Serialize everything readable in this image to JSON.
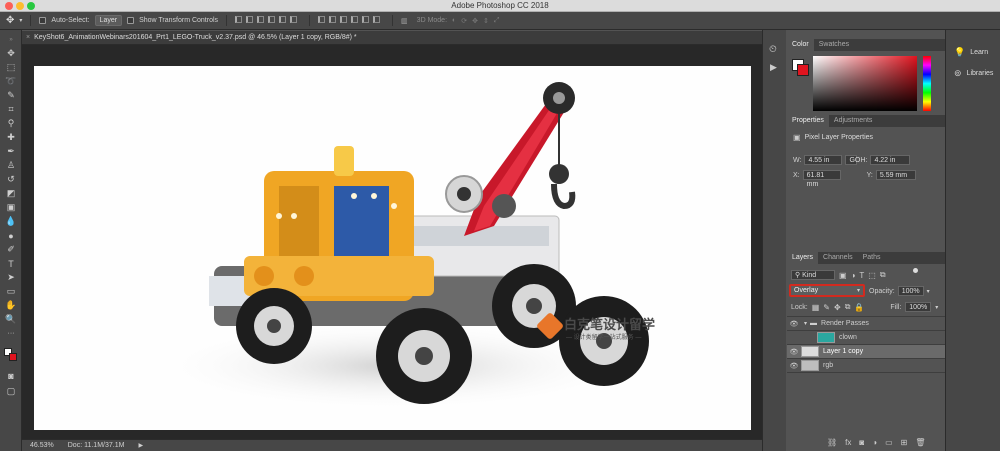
{
  "window": {
    "title": "Adobe Photoshop CC 2018"
  },
  "options_bar": {
    "auto_select_label": "Auto-Select:",
    "auto_select_value": "Layer",
    "show_transform_label": "Show Transform Controls",
    "mode_label": "3D Mode:"
  },
  "document": {
    "tab_title": "KeyShot6_AnimationWebinars201604_Prt1_LEGO-Truck_v2.37.psd @ 46.5% (Layer 1 copy, RGB/8#) *"
  },
  "status": {
    "zoom": "46.53%",
    "doc_size": "Doc: 11.1M/37.1M"
  },
  "watermark": {
    "title": "白克笔设计留学",
    "subtitle": "— 设计类留学一站式服务 —"
  },
  "color_panel": {
    "tabs": [
      "Color",
      "Swatches"
    ],
    "fg": "#ffffff",
    "bg": "#e0141f"
  },
  "properties_panel": {
    "tabs": [
      "Properties",
      "Adjustments"
    ],
    "header": "Pixel Layer Properties",
    "w_label": "W:",
    "w_value": "4.55 in",
    "h_label": "H:",
    "h_value": "4.22 in",
    "x_label": "X:",
    "x_value": "61.81 mm",
    "y_label": "Y:",
    "y_value": "5.59 mm",
    "link_label": "GO"
  },
  "layers_panel": {
    "tabs": [
      "Layers",
      "Channels",
      "Paths"
    ],
    "kind_label": "Kind",
    "blend_mode": "Overlay",
    "opacity_label": "Opacity:",
    "opacity_value": "100%",
    "lock_label": "Lock:",
    "fill_label": "Fill:",
    "fill_value": "100%",
    "layers": [
      {
        "name": "Render Passes",
        "type": "group"
      },
      {
        "name": "clown",
        "type": "layer"
      },
      {
        "name": "Layer 1 copy",
        "type": "layer"
      },
      {
        "name": "rgb",
        "type": "layer"
      }
    ],
    "bottom_icons": [
      "link-icon",
      "fx-icon",
      "mask-icon",
      "adjustment-icon",
      "folder-icon",
      "new-layer-icon",
      "trash-icon"
    ]
  },
  "right_panel": {
    "learn_label": "Learn",
    "libraries_label": "Libraries"
  }
}
